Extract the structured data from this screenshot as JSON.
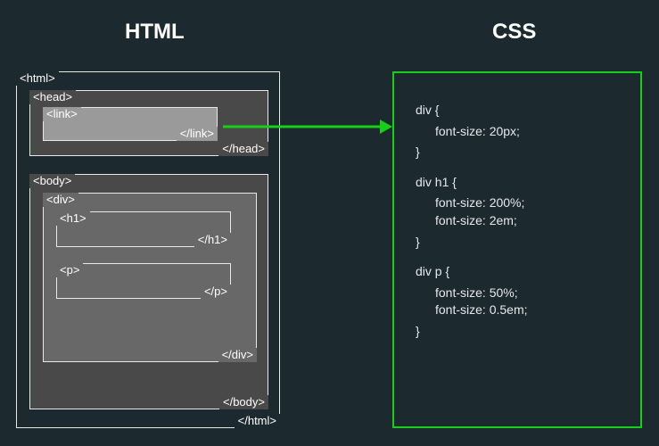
{
  "headings": {
    "html": "HTML",
    "css": "CSS"
  },
  "html_tree": {
    "html_open": "<html>",
    "html_close": "</html>",
    "head_open": "<head>",
    "head_close": "</head>",
    "link_open": "<link>",
    "link_close": "</link>",
    "body_open": "<body>",
    "body_close": "</body>",
    "div_open": "<div>",
    "div_close": "</div>",
    "h1_open": "<h1>",
    "h1_close": "</h1>",
    "p_open": "<p>",
    "p_close": "</p>"
  },
  "css_rules": [
    {
      "selector": "div {",
      "declarations": [
        "font-size: 20px;"
      ],
      "close": "}"
    },
    {
      "selector": "div h1 {",
      "declarations": [
        "font-size: 200%;",
        "font-size: 2em;"
      ],
      "close": "}"
    },
    {
      "selector": "div p {",
      "declarations": [
        "font-size: 50%;",
        "font-size: 0.5em;"
      ],
      "close": "}"
    }
  ],
  "arrow": {
    "color": "#18cf18"
  }
}
